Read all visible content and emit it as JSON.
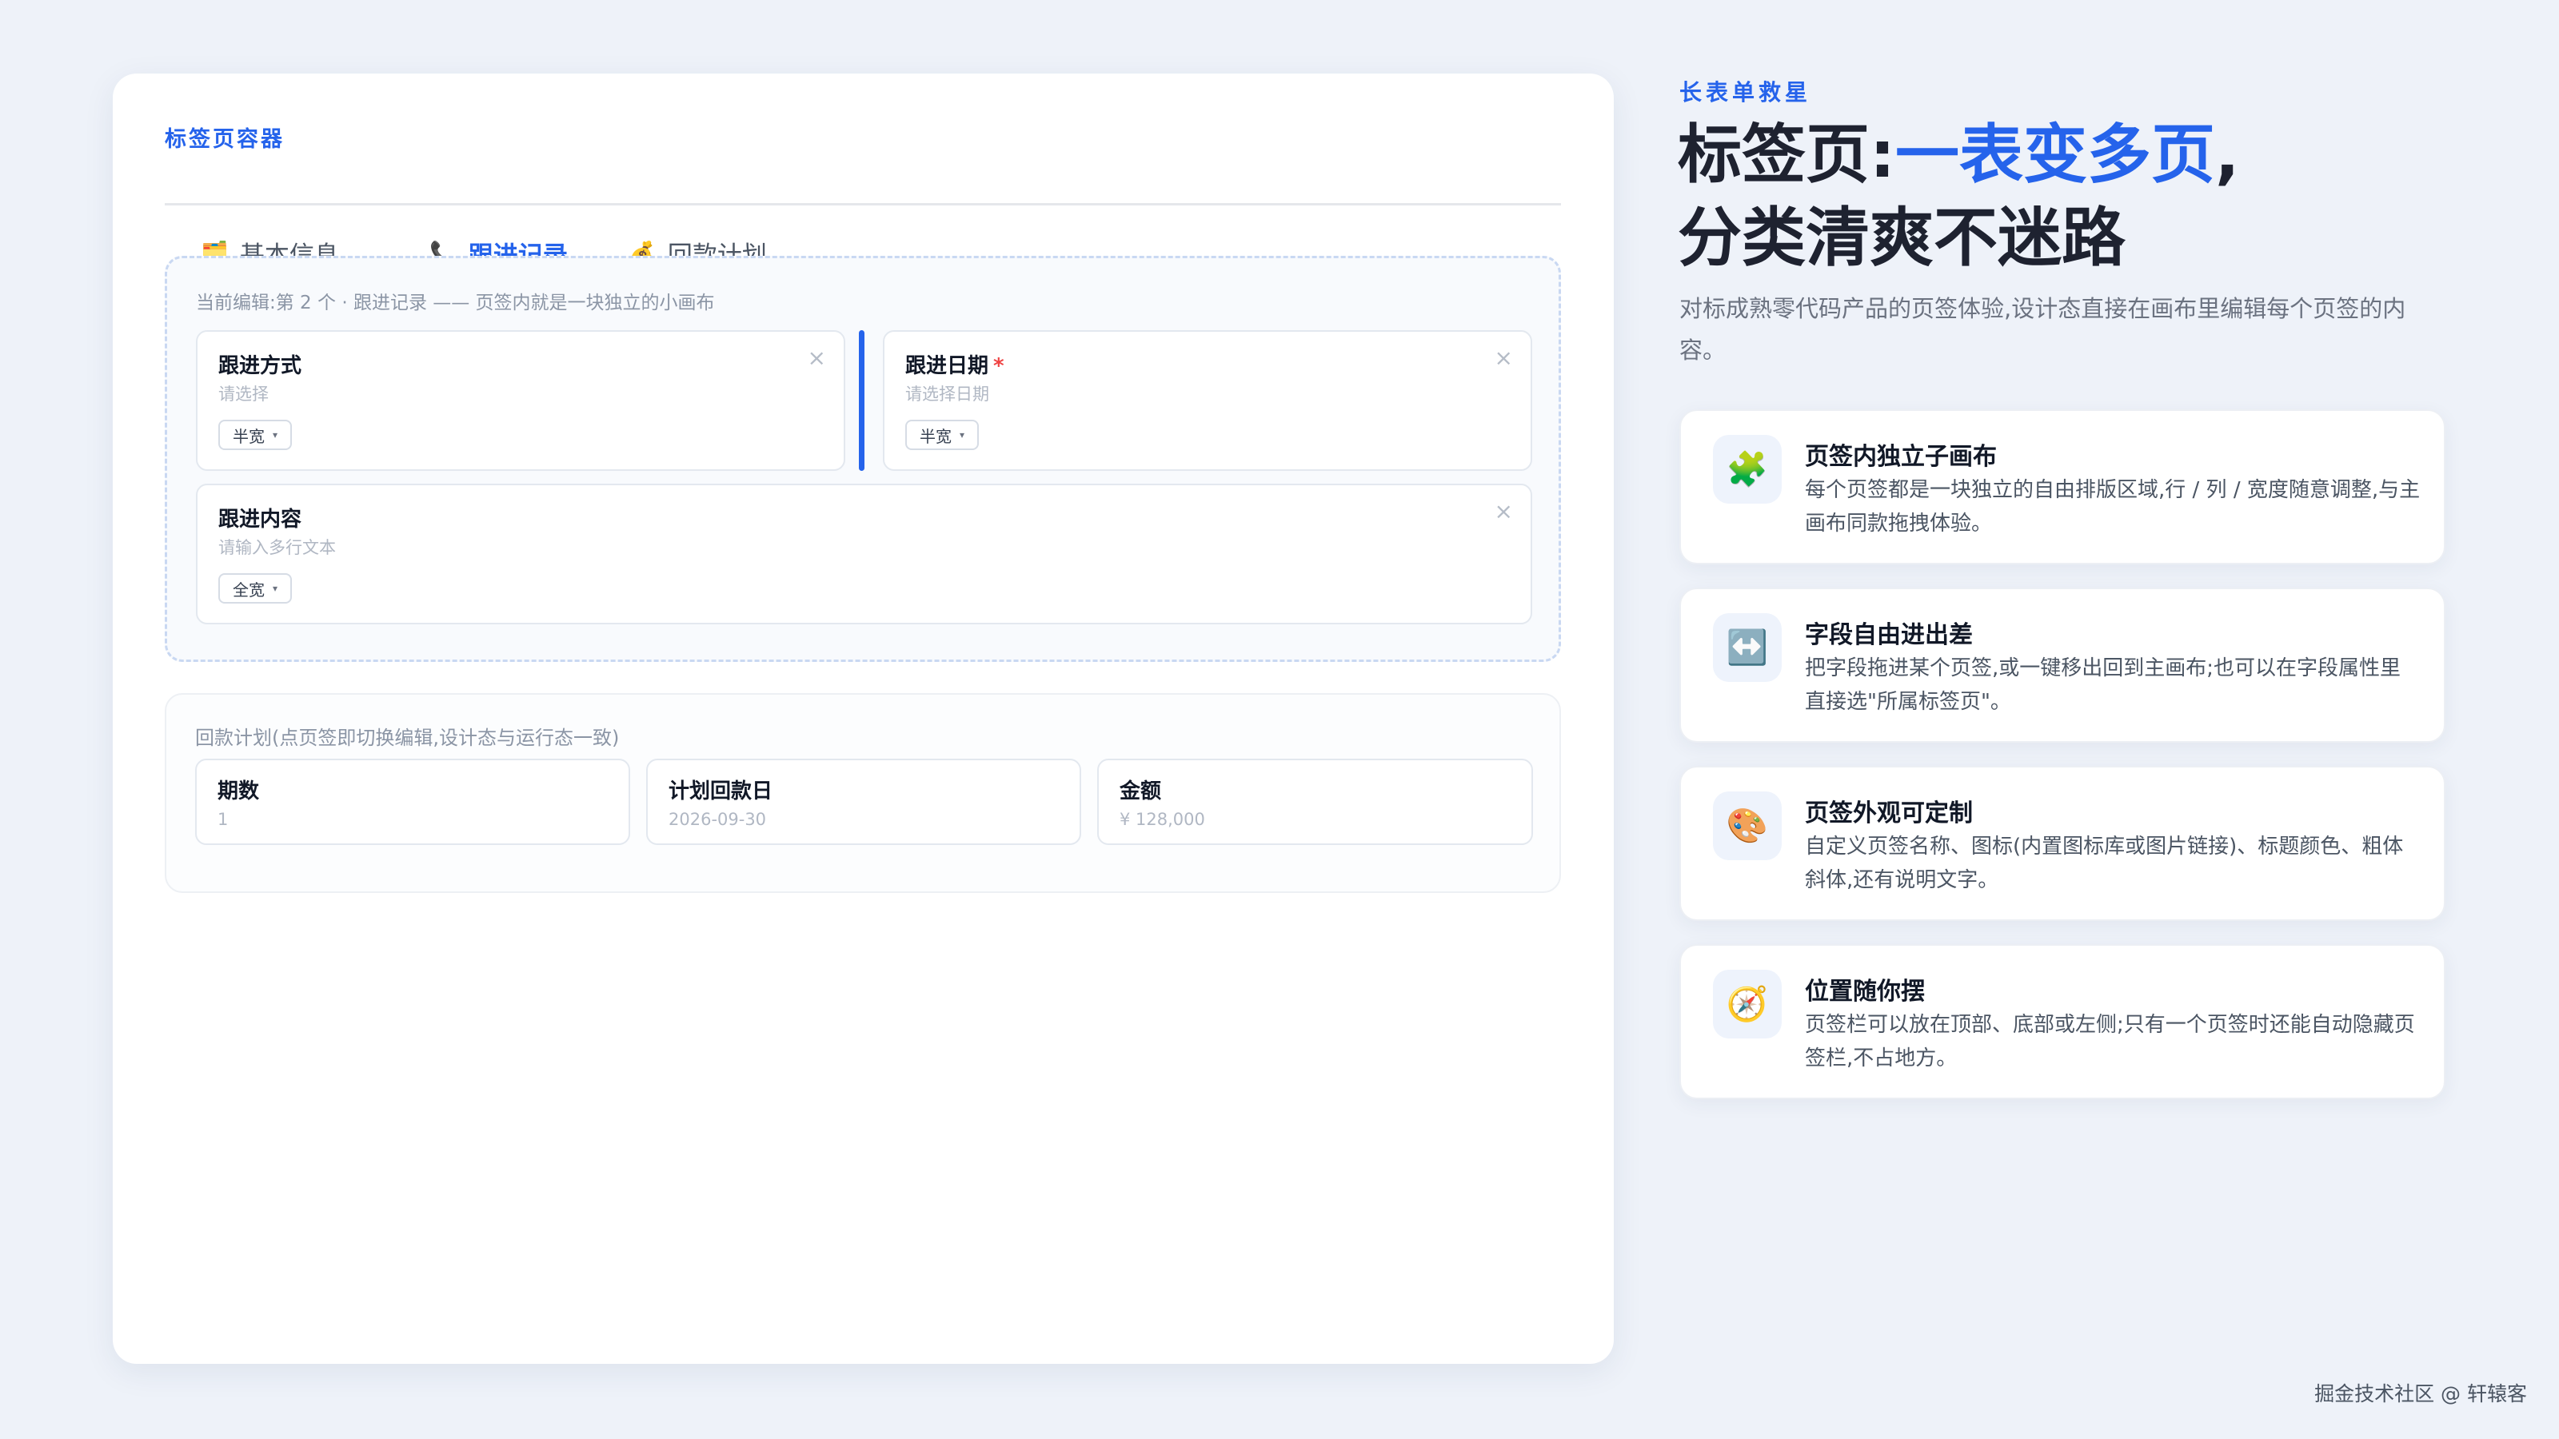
{
  "designer": {
    "title": "标签页容器",
    "tabs": [
      {
        "icon": "🗂️",
        "label": "基本信息",
        "active": false
      },
      {
        "icon": "📞",
        "label": "跟进记录",
        "active": true
      },
      {
        "icon": "💰",
        "label": "回款计划",
        "active": false
      }
    ],
    "canvas": {
      "hint": "当前编辑:第 2 个 · 跟进记录 —— 页签内就是一块独立的小画布",
      "fields": [
        {
          "label": "跟进方式",
          "required": false,
          "placeholder": "请选择",
          "width": "半宽"
        },
        {
          "label": "跟进日期",
          "required": true,
          "required_mark": "*",
          "placeholder": "请选择日期",
          "width": "半宽"
        },
        {
          "label": "跟进内容",
          "required": false,
          "placeholder": "请输入多行文本",
          "width": "全宽"
        }
      ],
      "close_symbol": "×",
      "caret": "▾"
    },
    "panel2": {
      "hint": "回款计划(点页签即切换编辑,设计态与运行态一致)",
      "fields": [
        {
          "label": "期数",
          "value": "1"
        },
        {
          "label": "计划回款日",
          "value": "2026-09-30"
        },
        {
          "label": "金额",
          "value": "¥ 128,000"
        }
      ]
    }
  },
  "hero": {
    "eyebrow": "长表单救星",
    "headline_prefix": "标签页:",
    "headline_highlight": "一表变多页",
    "headline_suffix": ",",
    "headline_line2": "分类清爽不迷路",
    "subtitle": "对标成熟零代码产品的页签体验,设计态直接在画布里编辑每个页签的内容。"
  },
  "features": [
    {
      "icon": "puzzle-icon",
      "glyph": "🧩",
      "title": "页签内独立子画布",
      "desc": "每个页签都是一块独立的自由排版区域,行 / 列 / 宽度随意调整,与主画布同款拖拽体验。"
    },
    {
      "icon": "left-right-arrow-icon",
      "glyph": "↔️",
      "title": "字段自由进出差",
      "desc": "把字段拖进某个页签,或一键移出回到主画布;也可以在字段属性里直接选\"所属标签页\"。"
    },
    {
      "icon": "palette-icon",
      "glyph": "🎨",
      "title": "页签外观可定制",
      "desc": "自定义页签名称、图标(内置图标库或图片链接)、标题颜色、粗体斜体,还有说明文字。"
    },
    {
      "icon": "compass-icon",
      "glyph": "🧭",
      "title": "位置随你摆",
      "desc": "页签栏可以放在顶部、底部或左侧;只有一个页签时还能自动隐藏页签栏,不占地方。"
    }
  ],
  "footer": "掘金技术社区 @ 轩辕客"
}
